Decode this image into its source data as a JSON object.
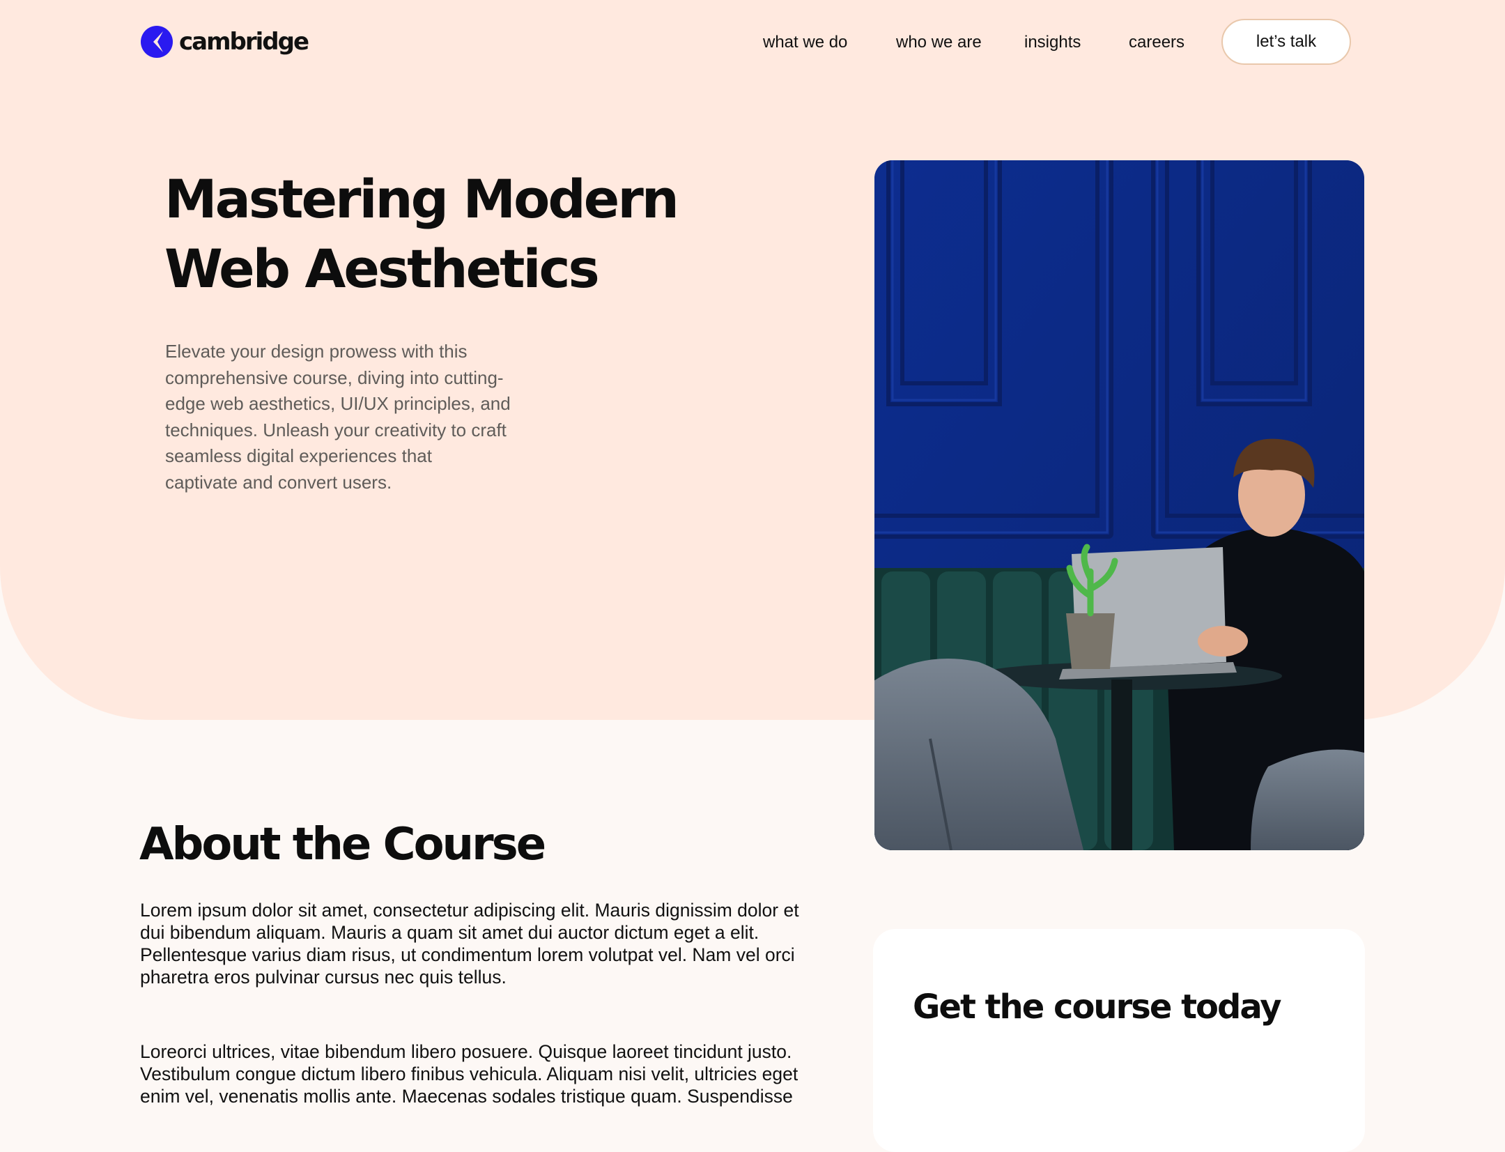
{
  "brand": {
    "name": "cambridge",
    "icon": "cambridge-logo-icon",
    "color": "#2a1af0"
  },
  "nav": {
    "items": [
      {
        "label": "what we do"
      },
      {
        "label": "who we are"
      },
      {
        "label": "insights"
      },
      {
        "label": "careers"
      }
    ],
    "cta_label": "let’s talk"
  },
  "hero": {
    "title_line1": "Mastering Modern",
    "title_line2": "Web Aesthetics",
    "description_lines": [
      "Elevate your design prowess with this",
      "comprehensive course, diving into cutting-",
      "edge web aesthetics, UI/UX principles, and",
      "techniques. Unleash your creativity to craft",
      "seamless digital experiences that",
      "captivate and convert users."
    ],
    "image": "man-with-laptop-photo",
    "background_color": "#ffe9df"
  },
  "about": {
    "title": "About the Course",
    "paragraph1_lines": [
      "Lorem ipsum dolor sit amet, consectetur adipiscing elit. Mauris dignissim dolor et",
      "dui bibendum aliquam. Mauris a quam sit amet dui auctor dictum eget a elit.",
      "Pellentesque varius diam risus, ut condimentum lorem volutpat vel. Nam vel orci",
      "pharetra eros pulvinar cursus nec quis tellus."
    ],
    "paragraph2_lines": [
      "Loreorci ultrices, vitae bibendum libero posuere. Quisque laoreet tincidunt justo.",
      "Vestibulum congue dictum libero finibus vehicula. Aliquam nisi velit, ultricies eget",
      "enim vel, venenatis mollis ante. Maecenas sodales tristique quam. Suspendisse"
    ]
  },
  "purchase_card": {
    "title": "Get the course today"
  }
}
